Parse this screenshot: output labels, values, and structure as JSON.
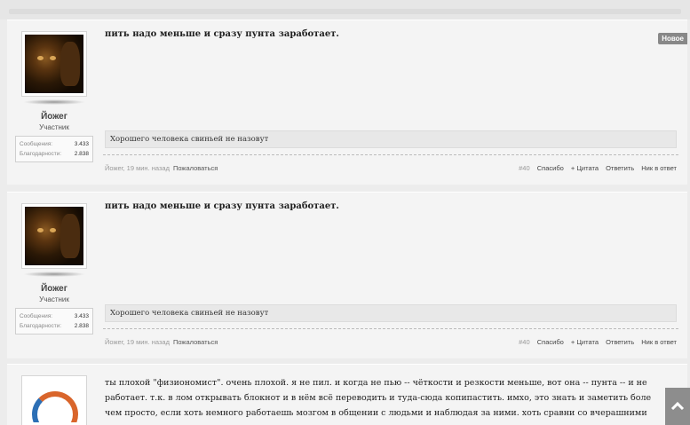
{
  "posts": [
    {
      "author": {
        "name": "Йожег",
        "role": "Участник",
        "stats": [
          {
            "label": "Сообщения:",
            "value": "3.433"
          },
          {
            "label": "Благодарности:",
            "value": "2.838"
          }
        ]
      },
      "message": "пить надо меньше и сразу пунта заработает.",
      "signature": "Хорошего человека свиньей не назовут",
      "meta": {
        "byline": "Йожег, 19 мин. назад",
        "report": "Пожаловаться",
        "number": "#40",
        "thanks": "Спасибо",
        "quote": "+ Цитата",
        "reply": "Ответить",
        "nick": "Ник в ответ"
      },
      "badge": "Новое"
    },
    {
      "author": {
        "name": "Йожег",
        "role": "Участник",
        "stats": [
          {
            "label": "Сообщения:",
            "value": "3.433"
          },
          {
            "label": "Благодарности:",
            "value": "2.838"
          }
        ]
      },
      "message": "пить надо меньше и сразу пунта заработает.",
      "signature": "Хорошего человека свиньей не назовут",
      "meta": {
        "byline": "Йожег, 19 мин. назад",
        "report": "Пожаловаться",
        "number": "#40",
        "thanks": "Спасибо",
        "quote": "+ Цитата",
        "reply": "Ответить",
        "nick": "Ник в ответ"
      }
    },
    {
      "lines": [
        "ты плохой \"физиономист\". очень плохой. я не пил. и когда не пью -- чёткости и резкости меньше, вот она -- пунта -- и не",
        "работает. т.к. в лом открывать блокнот и в нём всё переводить и туда-сюда копипастить. имхо, это знать и заметить боле",
        "чем просто, если хоть немного работаешь мозгом в общении с людьми и наблюдая за ними. хоть сравни со вчерашними"
      ]
    }
  ]
}
